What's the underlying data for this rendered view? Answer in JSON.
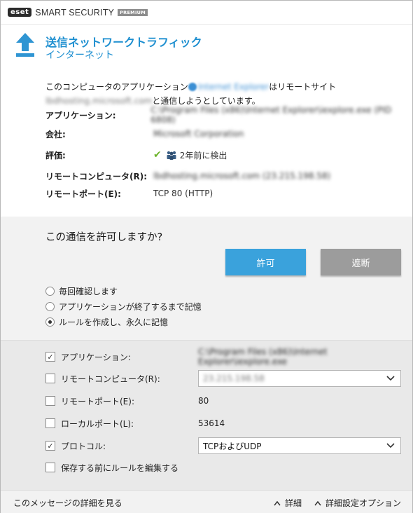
{
  "titlebar": {
    "logo": "eset",
    "brand": "SMART SECURITY",
    "edition": "PREMIUM"
  },
  "header": {
    "icon": "upload-arrow-icon",
    "title": "送信ネットワークトラフィック",
    "subtitle": "インターネット",
    "accent": "#1e8fd0"
  },
  "description": {
    "part1": "このコンピュータのアプリケーション",
    "app_name": "Internet Explorer",
    "part2": "はリモートサイト",
    "remote_site": "lbdhosting.microsoft.com",
    "part3": "と通信しようとしています。"
  },
  "info": [
    {
      "label": "アプリケーション:",
      "value": "C:\\Program Files (x86)\\Internet Explorer\\iexplore.exe (PID 6808)",
      "blurred": true
    },
    {
      "label": "会社:",
      "value": "Microsoft Corporation",
      "blurred": true,
      "link": true
    },
    {
      "label": "評価:",
      "value": "2年前に検出",
      "blurred": false
    },
    {
      "label": "リモートコンピュータ(R):",
      "value": "lbdhosting.microsoft.com (23.215.198.58)",
      "blurred": true
    },
    {
      "label": "リモートポート(E):",
      "value": "TCP 80 (HTTP)",
      "blurred": false
    }
  ],
  "question": {
    "text": "この通信を許可しますか?",
    "allow_label": "許可",
    "deny_label": "遮断",
    "allow_color": "#3aa2dc",
    "deny_color": "#9c9c9c"
  },
  "radios": [
    {
      "label": "毎回確認します",
      "checked": false
    },
    {
      "label": "アプリケーションが終了するまで記憶",
      "checked": false
    },
    {
      "label": "ルールを作成し、永久に記憶",
      "checked": true
    }
  ],
  "options": {
    "application": {
      "label": "アプリケーション:",
      "checked": true,
      "value": "C:\\Program Files (x86)\\Internet Explorer\\iexplore.exe"
    },
    "remote_computer": {
      "label": "リモートコンピュータ(R):",
      "checked": false,
      "value": "23.215.198.58"
    },
    "remote_port": {
      "label": "リモートポート(E):",
      "checked": false,
      "value": "80"
    },
    "local_port": {
      "label": "ローカルポート(L):",
      "checked": false,
      "value": "53614"
    },
    "protocol": {
      "label": "プロトコル:",
      "checked": true,
      "value": "TCPおよびUDP"
    },
    "edit_rule": {
      "label": "保存する前にルールを編集する",
      "checked": false
    }
  },
  "footer": {
    "details_link": "このメッセージの詳細を見る",
    "details_button": "詳細",
    "advanced_button": "詳細設定オプション"
  }
}
